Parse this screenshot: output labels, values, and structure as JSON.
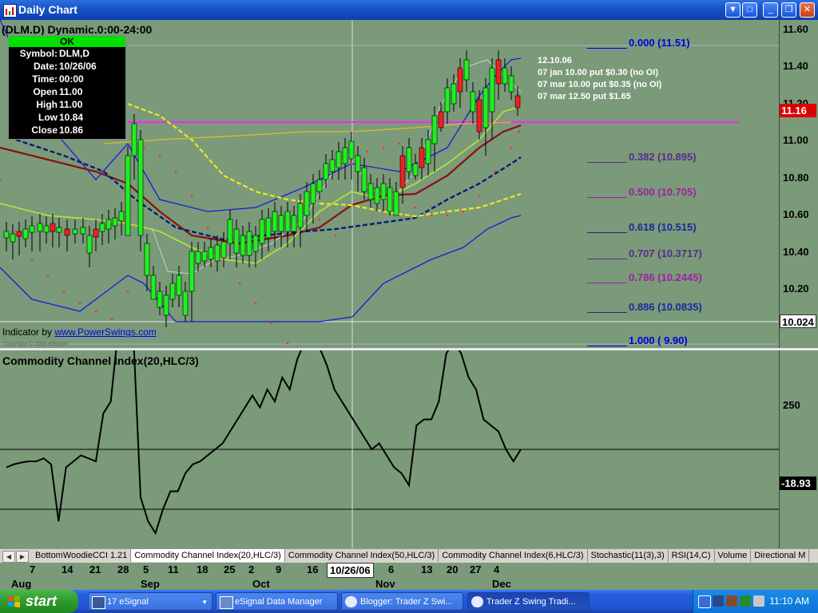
{
  "window": {
    "title": "Daily Chart"
  },
  "chart_header": {
    "symbol_line": "(DLM.D) Dynamic.0:00-24:00"
  },
  "info_box": {
    "status": "OK",
    "rows": [
      {
        "label": "Symbol:",
        "value": "DLM,D"
      },
      {
        "label": "Date:",
        "value": "10/26/06"
      },
      {
        "label": "Time:",
        "value": "00:00"
      },
      {
        "label": "Open",
        "value": "11.00"
      },
      {
        "label": "High",
        "value": "11.00"
      },
      {
        "label": "Low",
        "value": "10.84"
      },
      {
        "label": "Close",
        "value": "10.86"
      }
    ]
  },
  "annotation": [
    "12.10.06",
    "07 jan 10.00 put $0.30 (no OI)",
    "07 mar 10.00 put $0.35 (no OI)",
    "07 mar 12.50 put $1.65"
  ],
  "fib_levels": [
    {
      "label": "0.000 (11.51)",
      "price": 11.51,
      "color": "#0000dd"
    },
    {
      "label": "0.382 (10.895)",
      "price": 10.895,
      "color": "#5a2a8a"
    },
    {
      "label": "0.500 (10.705)",
      "price": 10.705,
      "color": "#a020a0"
    },
    {
      "label": "0.618 (10.515)",
      "price": 10.515,
      "color": "#1a2a9a"
    },
    {
      "label": "0.707 (10.3717)",
      "price": 10.3717,
      "color": "#5a2a8a"
    },
    {
      "label": "0.786 (10.2445)",
      "price": 10.2445,
      "color": "#a020a0"
    },
    {
      "label": "0.886 (10.0835)",
      "price": 10.0835,
      "color": "#1a2a9a"
    },
    {
      "label": "1.000 ( 9.90)",
      "price": 9.9,
      "color": "#0000dd"
    }
  ],
  "price_axis": {
    "ticks": [
      "11.60",
      "11.40",
      "11.20",
      "11.00",
      "10.80",
      "10.60",
      "10.40",
      "10.20"
    ],
    "last_price": "11.16",
    "last_price_color": "#dd0000",
    "crosshair_price": "10.024"
  },
  "indicator_credit": {
    "prefix": "Indicator by ",
    "link": "www.PowerSwings.com"
  },
  "copyright": "Copyright © 2006 eSignal",
  "cci": {
    "title": "Commodity Channel Index(20,HLC/3)",
    "ticks": [
      "250"
    ],
    "last_value": "-18.93"
  },
  "chart_data": {
    "type": "line",
    "title": "Commodity Channel Index(20,HLC/3)",
    "series": [
      {
        "name": "Commodity Channel Index(20,HLC/3)",
        "values": [
          -30,
          -25,
          -22,
          -20,
          -20,
          -15,
          -25,
          -120,
          -30,
          -20,
          -10,
          -15,
          -20,
          60,
          80,
          200,
          320,
          200,
          -80,
          -120,
          -140,
          -100,
          -70,
          -70,
          -40,
          -25,
          -20,
          -10,
          0,
          10,
          30,
          50,
          70,
          90,
          70,
          100,
          80,
          120,
          100,
          150,
          180,
          190,
          170,
          140,
          100,
          80,
          60,
          40,
          20,
          0,
          10,
          -10,
          -30,
          -40,
          -60,
          40,
          50,
          50,
          80,
          160,
          180,
          160,
          120,
          100,
          50,
          40,
          30,
          0,
          -20,
          0
        ]
      }
    ]
  },
  "tabs": [
    "BottomWoodieCCI 1.21",
    "Commodity Channel Index(20,HLC/3)",
    "Commodity Channel Index(50,HLC/3)",
    "Commodity Channel Index(6,HLC/3)",
    "Stochastic(11(3),3)",
    "RSI(14,C)",
    "Volume",
    "Directional M"
  ],
  "active_tab": 1,
  "date_axis": {
    "days": [
      "7",
      "14",
      "21",
      "28",
      "5",
      "11",
      "18",
      "25",
      "2",
      "9",
      "16",
      "6",
      "13",
      "20",
      "27",
      "4"
    ],
    "selected": "10/26/06",
    "months": [
      "Aug",
      "Sep",
      "Oct",
      "Nov",
      "Dec"
    ]
  },
  "taskbar": {
    "start": "start",
    "buttons": [
      "17 eSignal",
      "eSignal Data Manager",
      "Blogger: Trader Z Swi...",
      "Trader Z Swing Tradi..."
    ],
    "clock": "11:10 AM"
  }
}
